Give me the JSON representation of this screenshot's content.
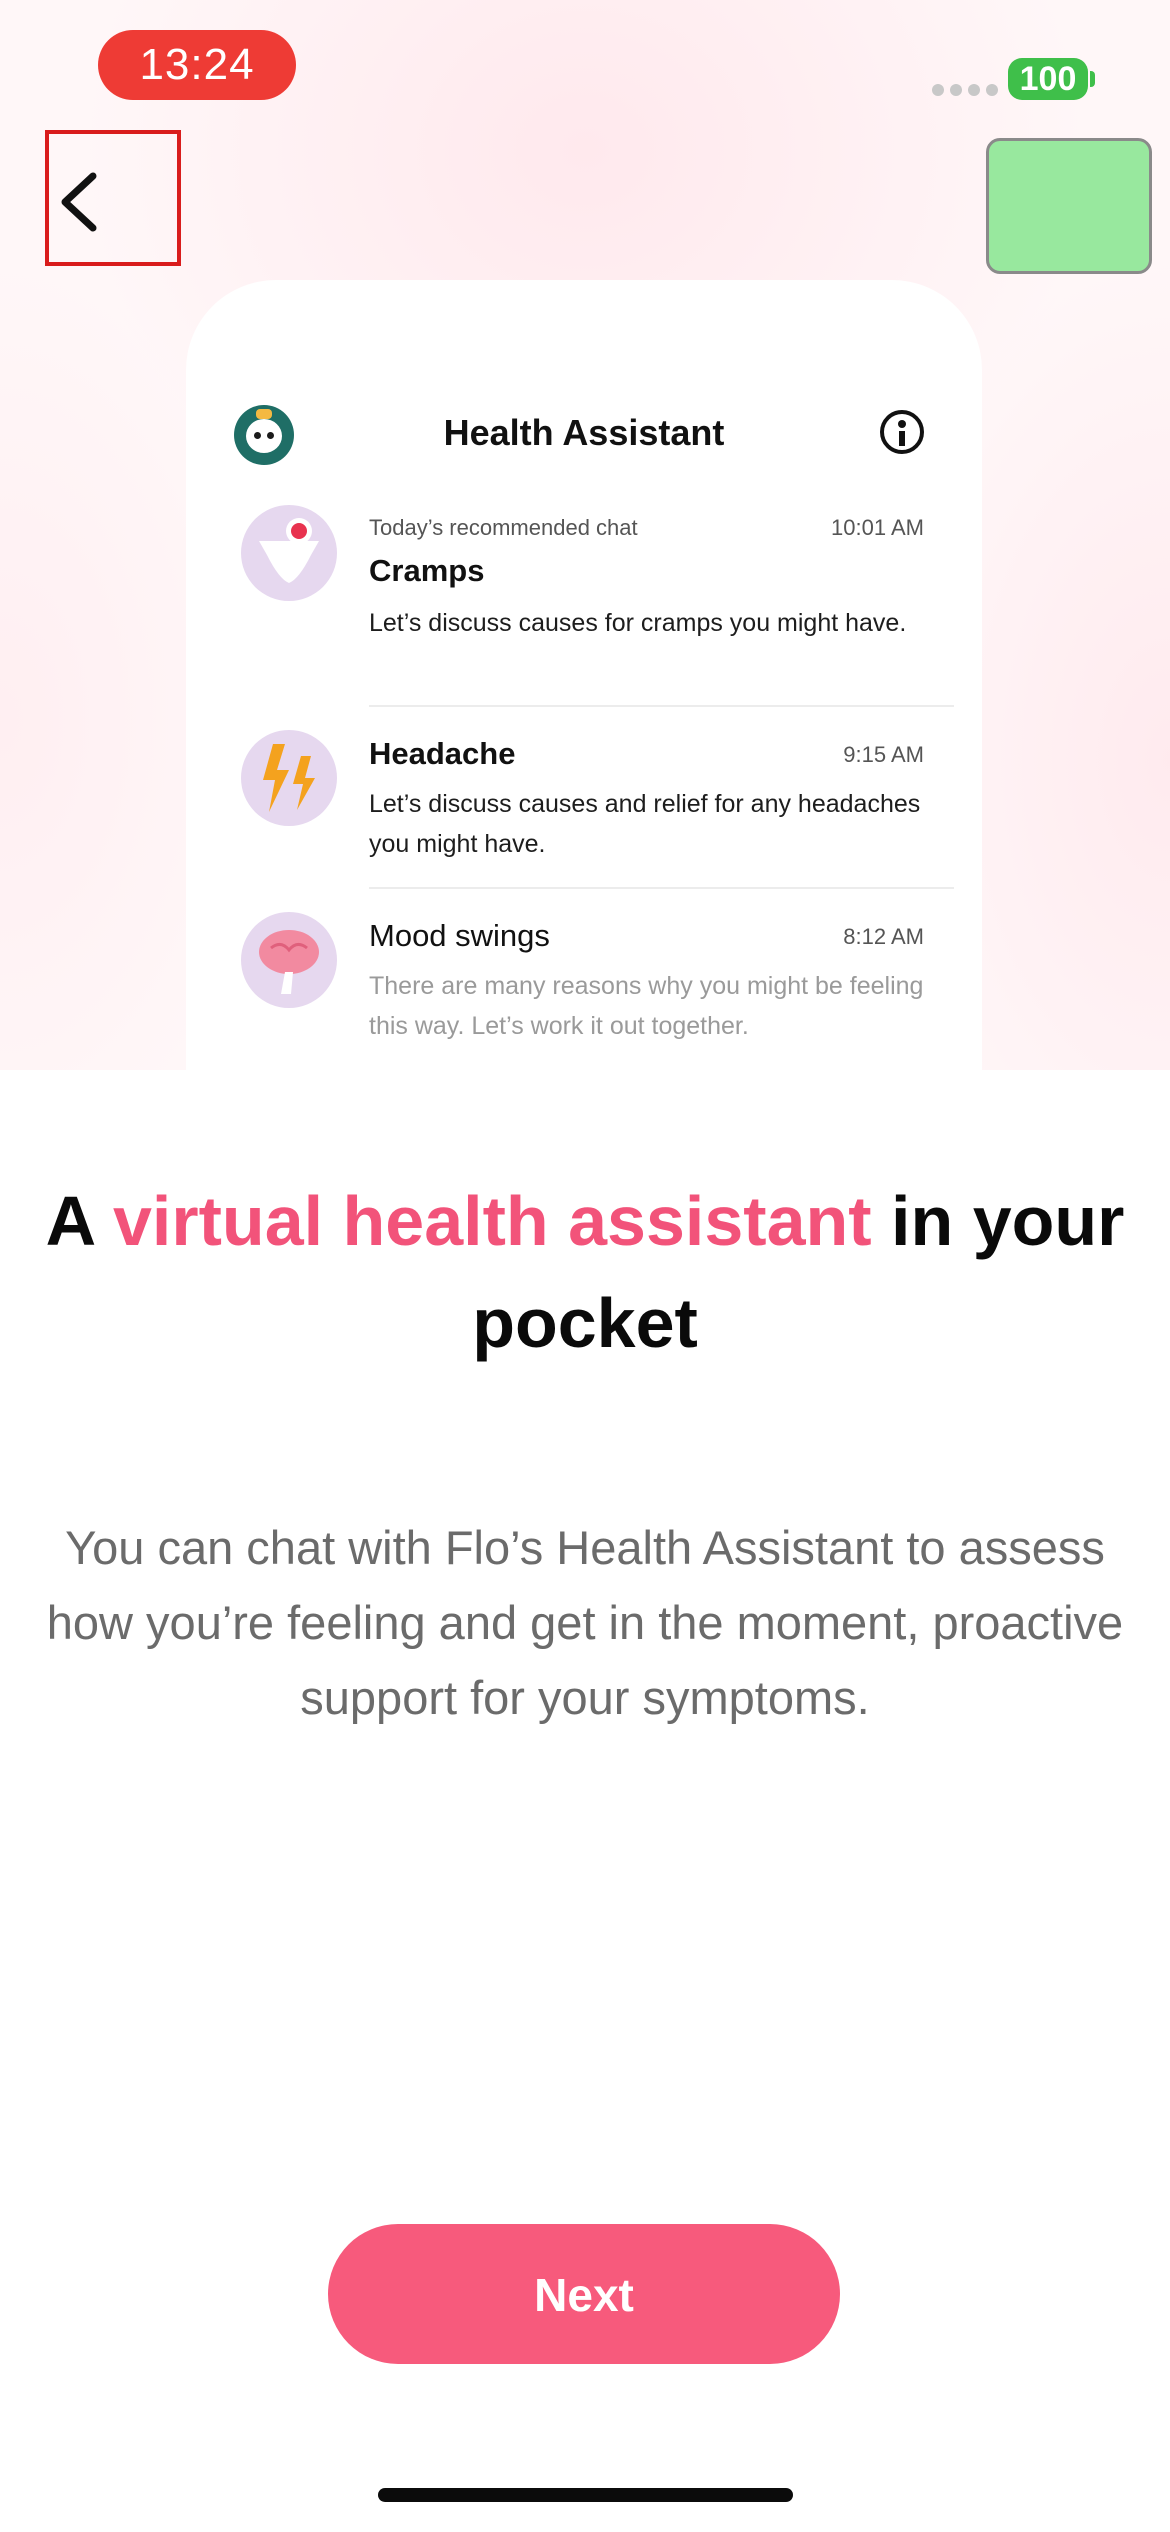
{
  "status_bar": {
    "time": "13:24",
    "battery": "100"
  },
  "nav": {
    "back_icon": "chevron-left-icon"
  },
  "assistant_card": {
    "title": "Health Assistant",
    "chats": [
      {
        "subtitle": "Today’s recommended chat",
        "time": "10:01 AM",
        "name": "Cramps",
        "message": "Let’s discuss causes for cramps you might have.",
        "icon": "cramps-icon"
      },
      {
        "time": "9:15 AM",
        "name": "Headache",
        "message": "Let’s discuss causes and relief for any headaches you might have.",
        "icon": "headache-icon"
      },
      {
        "time": "8:12 AM",
        "name": "Mood swings",
        "message": "There are many reasons why you might be feeling this way. Let’s work it out together.",
        "icon": "mood-swings-icon"
      }
    ]
  },
  "headline": {
    "part1": "A ",
    "accent": "virtual health assistant",
    "part2": " in your pocket"
  },
  "description": "You can chat with Flo’s Health Assistant to assess how you’re feeling and get in the moment, proactive support for your symptoms.",
  "next_button": "Next",
  "colors": {
    "accent": "#f2537a",
    "button": "#f75a7c",
    "time_pill": "#ee3b35",
    "battery": "#3fbf4a"
  }
}
